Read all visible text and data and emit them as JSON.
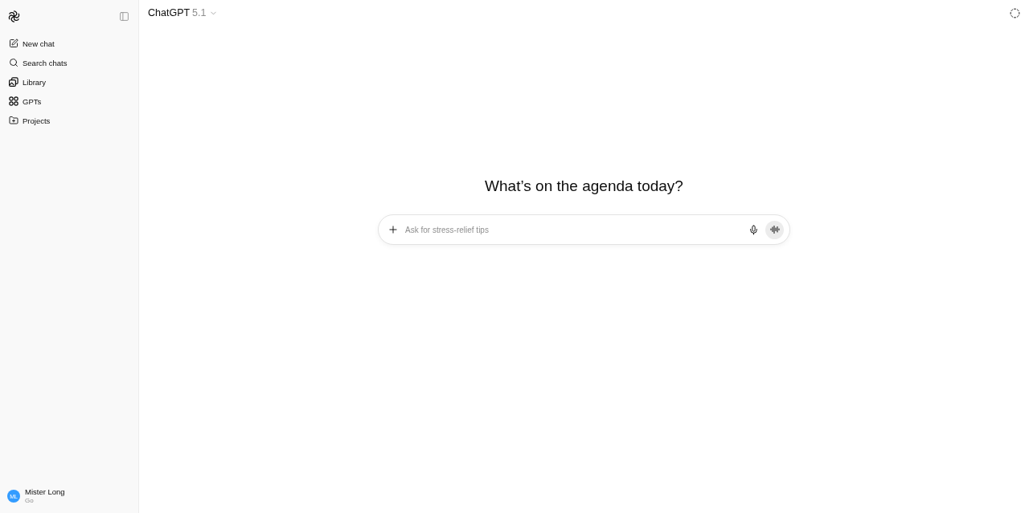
{
  "sidebar": {
    "nav_items": [
      {
        "label": "New chat"
      },
      {
        "label": "Search chats"
      },
      {
        "label": "Library"
      },
      {
        "label": "GPTs"
      },
      {
        "label": "Projects"
      }
    ],
    "user": {
      "initials": "ML",
      "name": "Mister Long",
      "plan": "Go"
    }
  },
  "header": {
    "model_selector": {
      "name": "ChatGPT",
      "version": "5.1"
    }
  },
  "main": {
    "heading": "What’s on the agenda today?",
    "composer": {
      "placeholder": "Ask for stress-relief tips"
    }
  }
}
